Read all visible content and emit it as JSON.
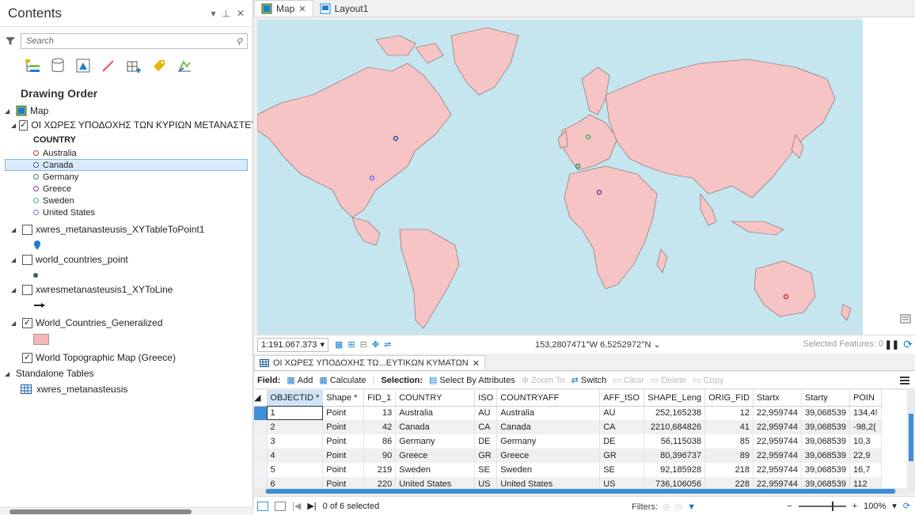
{
  "contents": {
    "title": "Contents",
    "search_placeholder": "Search",
    "drawing_order": "Drawing Order",
    "map_label": "Map",
    "layer1": "ΟΙ ΧΩΡΕΣ ΥΠΟΔΟΧΗΣ ΤΩΝ ΚΥΡΙΩΝ ΜΕΤΑΝΑΣΤΕΥΤ",
    "legend_field": "COUNTRY",
    "legend": [
      {
        "label": "Australia",
        "color": "#c0392b"
      },
      {
        "label": "Canada",
        "color": "#1f4fa8"
      },
      {
        "label": "Germany",
        "color": "#2e8b57"
      },
      {
        "label": "Greece",
        "color": "#8e3a8e"
      },
      {
        "label": "Sweden",
        "color": "#3cb371"
      },
      {
        "label": "United States",
        "color": "#7b68ee"
      }
    ],
    "layer2": "xwres_metanasteusis_XYTableToPoint1",
    "layer3": "world_countries_point",
    "layer4": "xwresmetanasteusis1_XYToLine",
    "layer5": "World_Countries_Generalized",
    "layer6": "World Topographic Map (Greece)",
    "standalone_tables": "Standalone Tables",
    "standalone_item": "xwres_metanasteusis"
  },
  "tabs": {
    "map": "Map",
    "layout": "Layout1"
  },
  "status": {
    "scale": "1:191.067.373",
    "coords": "153,2807471°W 6,5252972°N",
    "selected": "Selected Features: 0"
  },
  "table": {
    "tab_label": "ΟΙ ΧΩΡΕΣ ΥΠΟΔΟΧΗΣ ΤΩ...ΕΥΤΙΚΩΝ ΚΥΜΑΤΩΝ",
    "toolbar": {
      "field": "Field:",
      "add": "Add",
      "calculate": "Calculate",
      "selection": "Selection:",
      "select_by_attr": "Select By Attributes",
      "zoom_to": "Zoom To",
      "switch": "Switch",
      "clear": "Clear",
      "delete": "Delete",
      "copy": "Copy"
    },
    "columns": [
      "OBJECTID *",
      "Shape *",
      "FID_1",
      "COUNTRY",
      "ISO",
      "COUNTRYAFF",
      "AFF_ISO",
      "SHAPE_Leng",
      "ORIG_FID",
      "Startx",
      "Starty",
      "POIN"
    ],
    "rows": [
      [
        "1",
        "Point",
        "13",
        "Australia",
        "AU",
        "Australia",
        "AU",
        "252,165238",
        "12",
        "22,959744",
        "39,068539",
        "134,4!"
      ],
      [
        "2",
        "Point",
        "42",
        "Canada",
        "CA",
        "Canada",
        "CA",
        "2210,684826",
        "41",
        "22,959744",
        "39,068539",
        "-98,2("
      ],
      [
        "3",
        "Point",
        "86",
        "Germany",
        "DE",
        "Germany",
        "DE",
        "56,115038",
        "85",
        "22,959744",
        "39,068539",
        "10,3"
      ],
      [
        "4",
        "Point",
        "90",
        "Greece",
        "GR",
        "Greece",
        "GR",
        "80,396737",
        "89",
        "22,959744",
        "39,068539",
        "22,9"
      ],
      [
        "5",
        "Point",
        "219",
        "Sweden",
        "SE",
        "Sweden",
        "SE",
        "92,185928",
        "218",
        "22,959744",
        "39,068539",
        "16,7"
      ],
      [
        "6",
        "Point",
        "220",
        "United States",
        "US",
        "United States",
        "US",
        "736,106056",
        "228",
        "22,959744",
        "39,068539",
        "112"
      ]
    ],
    "selected_text": "0 of 6 selected",
    "filters": "Filters:",
    "zoom": "100%"
  }
}
